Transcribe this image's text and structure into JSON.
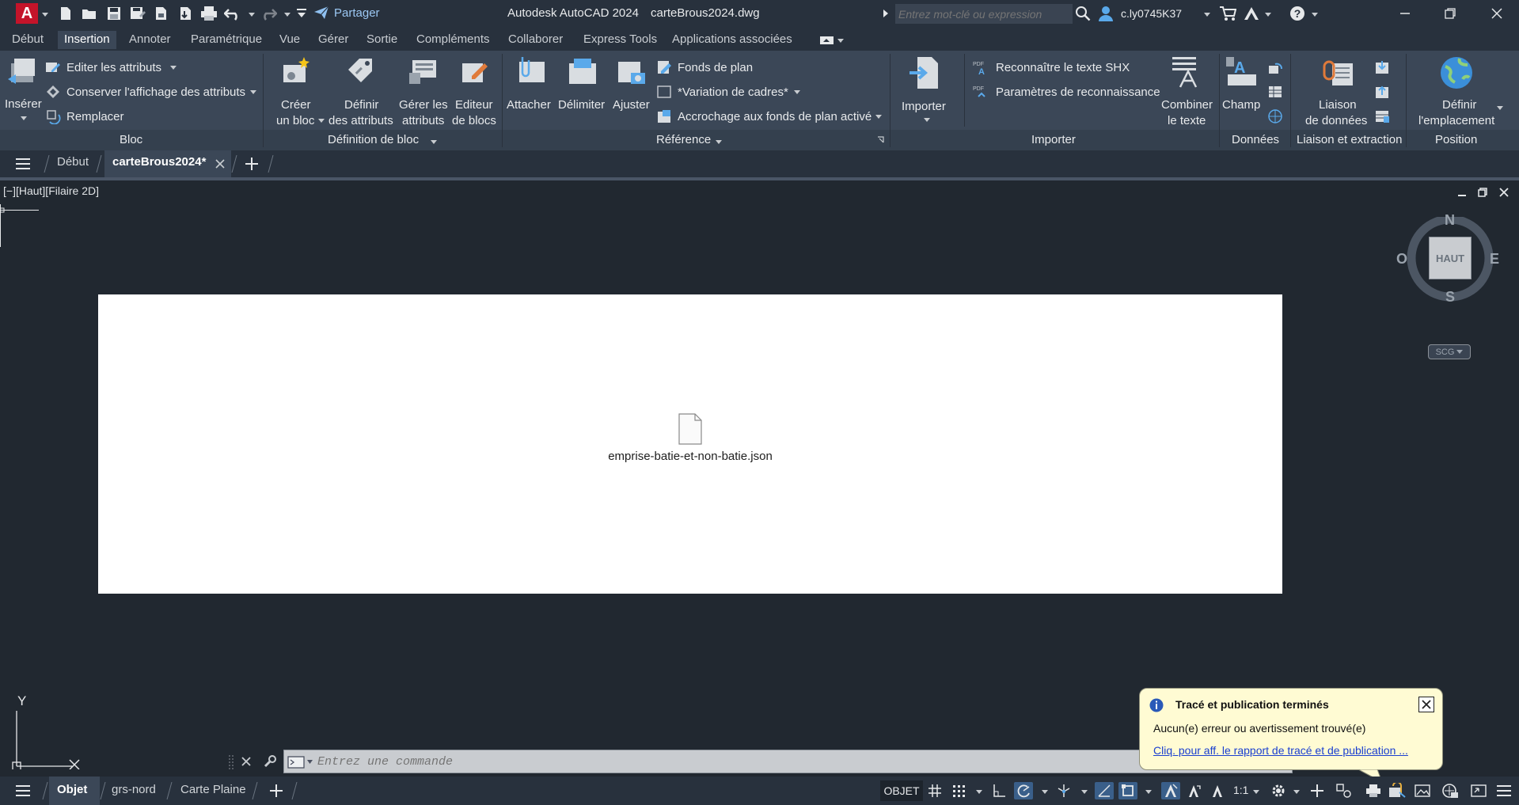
{
  "titlebar": {
    "app_logo": "A",
    "share_label": "Partager",
    "app_title": "Autodesk AutoCAD 2024",
    "file_title": "carteBrous2024.dwg",
    "search_placeholder": "Entrez mot-clé ou expression",
    "username": "c.ly0745K37"
  },
  "menu_tabs": [
    "Début",
    "Insertion",
    "Annoter",
    "Paramétrique",
    "Vue",
    "Gérer",
    "Sortie",
    "Compléments",
    "Collaborer",
    "Express Tools",
    "Applications associées"
  ],
  "ribbon": {
    "bloc": {
      "insert_label": "Insérer",
      "edit_attrs": "Editer les attributs",
      "keep_attrs": "Conserver l'affichage des attributs",
      "replace": "Remplacer",
      "title": "Bloc"
    },
    "block_def": {
      "create_l1": "Créer",
      "create_l2": "un bloc",
      "define_l1": "Définir",
      "define_l2": "des attributs",
      "manage_l1": "Gérer les",
      "manage_l2": "attributs",
      "editor_l1": "Editeur",
      "editor_l2": "de blocs",
      "title": "Définition de bloc"
    },
    "reference": {
      "attach": "Attacher",
      "clip": "Délimiter",
      "adjust": "Ajuster",
      "underlay": "Fonds de plan",
      "frames": "*Variation de cadres*",
      "snap_underlay": "Accrochage aux fonds de plan activé",
      "title": "Référence"
    },
    "import": {
      "import_label": "Importer",
      "recognize_shx": "Reconnaître le texte SHX",
      "recognize_params": "Paramètres de reconnaissance",
      "combine_l1": "Combiner",
      "combine_l2": "le texte",
      "title": "Importer"
    },
    "data": {
      "field": "Champ",
      "title": "Données"
    },
    "link": {
      "link_l1": "Liaison",
      "link_l2": "de données",
      "title": "Liaison et extraction"
    },
    "location": {
      "set_l1": "Définir",
      "set_l2": "l'emplacement",
      "title": "Position"
    }
  },
  "doc_tabs": {
    "start": "Début",
    "active": "carteBrous2024*"
  },
  "viewport": {
    "label": "[−][Haut][Filaire 2D]",
    "file_name": "emprise-batie-et-non-batie.json"
  },
  "viewcube": {
    "north": "N",
    "south": "S",
    "east": "E",
    "west": "O",
    "face": "HAUT",
    "ucs": "SCG"
  },
  "ucs_icon": {
    "y_label": "Y"
  },
  "command_line": {
    "placeholder": "Entrez une commande"
  },
  "notification": {
    "title": "Tracé et publication terminés",
    "message": "Aucun(e) erreur ou avertissement trouvé(e)",
    "link": "Cliq. pour aff. le rapport de tracé et de publication ..."
  },
  "status_bar": {
    "model_tab": "Objet",
    "layouts": [
      "grs-nord",
      "Carte Plaine"
    ],
    "mode_label": "OBJET",
    "scale": "1:1"
  },
  "colors": {
    "titlebar_bg": "#28313d",
    "ribbon_bg": "#3b4757",
    "drawing_bg": "#212830",
    "notif_bg": "#fffbd3",
    "accent_blue": "#2a6db5"
  }
}
